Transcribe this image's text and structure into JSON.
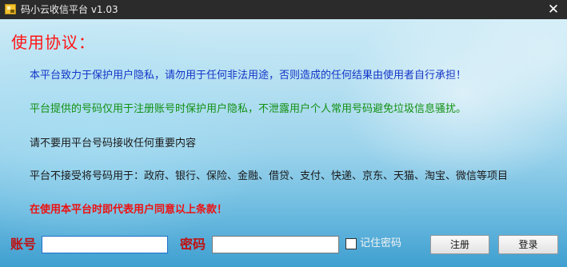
{
  "window": {
    "title": "码小云收信平台 v1.03",
    "close_symbol": "✕"
  },
  "agreement": {
    "heading": "使用协议：",
    "lines": [
      "本平台致力于保护用户隐私，请勿用于任何非法用途，否则造成的任何结果由使用者自行承担！",
      "平台提供的号码仅用于注册账号时保护用户隐私，不泄露用户个人常用号码避免垃圾信息骚扰。",
      "请不要用平台号码接收任何重要内容",
      "平台不接受将号码用于：政府、银行、保险、金融、借贷、支付、快递、京东、天猫、淘宝、微信等项目",
      "在使用本平台时即代表用户同意以上条款！"
    ]
  },
  "login": {
    "account_label": "账号",
    "account_value": "",
    "password_label": "密码",
    "password_value": "",
    "remember_label": "记住密码",
    "remember_checked": false,
    "register_button": "注册",
    "login_button": "登录"
  },
  "colors": {
    "heading": "#ff1414",
    "line_blue": "#1436c8",
    "line_green": "#139113",
    "line_black": "#1a1a1a",
    "line_red": "#ee1111",
    "field_label": "#c01010"
  }
}
